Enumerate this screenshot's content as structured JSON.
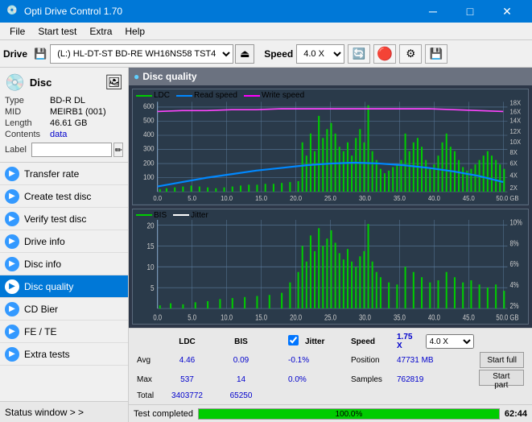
{
  "app": {
    "title": "Opti Drive Control 1.70",
    "icon": "💿"
  },
  "titlebar": {
    "minimize": "─",
    "maximize": "□",
    "close": "✕"
  },
  "menu": {
    "items": [
      "File",
      "Start test",
      "Extra",
      "Help"
    ]
  },
  "toolbar": {
    "drive_label": "Drive",
    "drive_value": "(L:)  HL-DT-ST BD-RE  WH16NS58 TST4",
    "speed_label": "Speed",
    "speed_value": "4.0 X"
  },
  "disc": {
    "section_label": "Disc",
    "type_key": "Type",
    "type_val": "BD-R DL",
    "mid_key": "MID",
    "mid_val": "MEIRB1 (001)",
    "length_key": "Length",
    "length_val": "46.61 GB",
    "contents_key": "Contents",
    "contents_val": "data",
    "label_key": "Label",
    "label_placeholder": ""
  },
  "nav": {
    "items": [
      {
        "id": "transfer-rate",
        "label": "Transfer rate",
        "active": false
      },
      {
        "id": "create-test-disc",
        "label": "Create test disc",
        "active": false
      },
      {
        "id": "verify-test-disc",
        "label": "Verify test disc",
        "active": false
      },
      {
        "id": "drive-info",
        "label": "Drive info",
        "active": false
      },
      {
        "id": "disc-info",
        "label": "Disc info",
        "active": false
      },
      {
        "id": "disc-quality",
        "label": "Disc quality",
        "active": true
      },
      {
        "id": "cd-bier",
        "label": "CD Bier",
        "active": false
      },
      {
        "id": "fe-te",
        "label": "FE / TE",
        "active": false
      },
      {
        "id": "extra-tests",
        "label": "Extra tests",
        "active": false
      }
    ],
    "status_window": "Status window > >"
  },
  "chart": {
    "title": "Disc quality",
    "top_chart": {
      "legend": [
        {
          "name": "LDC",
          "color": "#00cc00"
        },
        {
          "name": "Read speed",
          "color": "#0088ff"
        },
        {
          "name": "Write speed",
          "color": "#ff00ff"
        }
      ],
      "y_labels_left": [
        "600",
        "500",
        "400",
        "300",
        "200",
        "100"
      ],
      "y_labels_right": [
        "18X",
        "16X",
        "14X",
        "12X",
        "10X",
        "8X",
        "6X",
        "4X",
        "2X"
      ],
      "x_labels": [
        "0.0",
        "5.0",
        "10.0",
        "15.0",
        "20.0",
        "25.0",
        "30.0",
        "35.0",
        "40.0",
        "45.0",
        "50.0 GB"
      ]
    },
    "bottom_chart": {
      "legend": [
        {
          "name": "BIS",
          "color": "#00cc00"
        },
        {
          "name": "Jitter",
          "color": "#ffffff"
        }
      ],
      "y_labels_left": [
        "20",
        "15",
        "10",
        "5"
      ],
      "y_labels_right": [
        "10%",
        "8%",
        "6%",
        "4%",
        "2%"
      ],
      "x_labels": [
        "0.0",
        "5.0",
        "10.0",
        "15.0",
        "20.0",
        "25.0",
        "30.0",
        "35.0",
        "40.0",
        "45.0",
        "50.0 GB"
      ]
    }
  },
  "stats": {
    "col_ldc": "LDC",
    "col_bis": "BIS",
    "jitter_label": "Jitter",
    "speed_label": "Speed",
    "position_label": "Position",
    "samples_label": "Samples",
    "avg_label": "Avg",
    "max_label": "Max",
    "total_label": "Total",
    "ldc_avg": "4.46",
    "ldc_max": "537",
    "ldc_total": "3403772",
    "bis_avg": "0.09",
    "bis_max": "14",
    "bis_total": "65250",
    "jitter_avg": "-0.1%",
    "jitter_max": "0.0%",
    "speed_val": "1.75 X",
    "speed_select": "4.0 X",
    "position_val": "47731 MB",
    "samples_val": "762819",
    "start_full": "Start full",
    "start_part": "Start part"
  },
  "statusbar": {
    "status_text": "Test completed",
    "progress": "100.0%",
    "progress_pct": 100,
    "time": "62:44"
  }
}
